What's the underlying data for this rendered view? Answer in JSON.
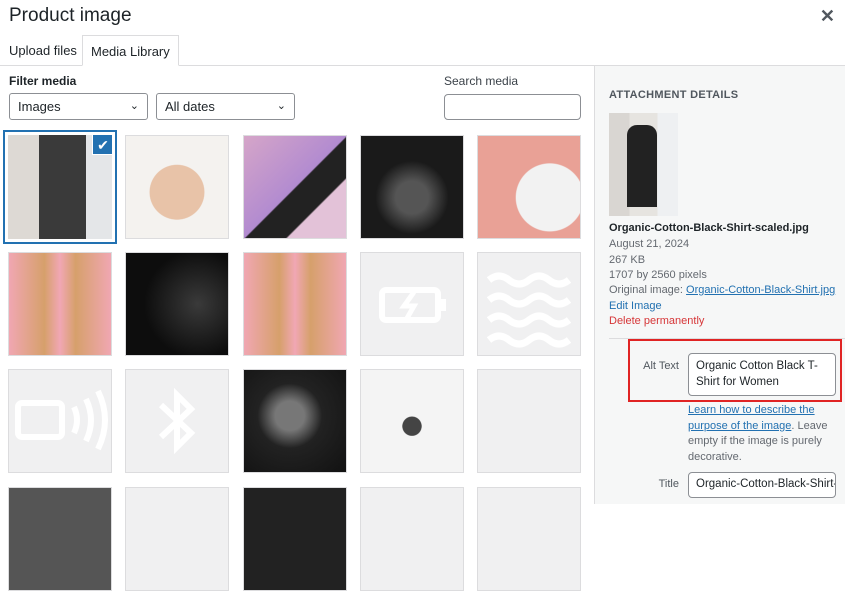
{
  "header": {
    "title": "Product image",
    "close_icon": "close-icon"
  },
  "tabs": [
    {
      "label": "Upload files"
    },
    {
      "label": "Media Library"
    }
  ],
  "filters": {
    "label": "Filter media",
    "type_value": "Images",
    "date_value": "All dates"
  },
  "search": {
    "label": "Search media",
    "value": ""
  },
  "tiles": [
    {
      "kind": "photo",
      "desc": "woman-black-shirt",
      "selected": true
    },
    {
      "kind": "photo",
      "desc": "pink-headphones"
    },
    {
      "kind": "photo",
      "desc": "headphones-on-laptop"
    },
    {
      "kind": "photo",
      "desc": "dark-headphones"
    },
    {
      "kind": "photo",
      "desc": "white-headphones-pink"
    },
    {
      "kind": "photo",
      "desc": "airpods-max-pink"
    },
    {
      "kind": "photo",
      "desc": "dark-closeup"
    },
    {
      "kind": "photo",
      "desc": "airpods-max-pink"
    },
    {
      "kind": "icon",
      "desc": "battery-charging-icon"
    },
    {
      "kind": "icon",
      "desc": "waves-icon"
    },
    {
      "kind": "icon",
      "desc": "speaker-waves-icon"
    },
    {
      "kind": "icon",
      "desc": "bluetooth-icon"
    },
    {
      "kind": "photo",
      "desc": "man-portrait-bw"
    },
    {
      "kind": "photo",
      "desc": "black-headphones-white"
    },
    {
      "kind": "blank",
      "desc": "blank"
    }
  ],
  "details": {
    "heading": "ATTACHMENT DETAILS",
    "filename": "Organic-Cotton-Black-Shirt-scaled.jpg",
    "date": "August 21, 2024",
    "size": "267 KB",
    "dimensions": "1707 by 2560 pixels",
    "original_label": "Original image:",
    "original_link": "Organic-Cotton-Black-Shirt.jpg",
    "edit": "Edit Image",
    "delete": "Delete permanently",
    "alt_label": "Alt Text",
    "alt_value": "Organic Cotton Black T-Shirt for Women",
    "help_link": "Learn how to describe the purpose of the image",
    "help_text": ". Leave empty if the image is purely decorative.",
    "title_label": "Title",
    "title_value": "Organic-Cotton-Black-Shirt-scaled"
  },
  "colors": {
    "accent": "#2271b1",
    "danger": "#d63638",
    "highlight": "#e02424"
  }
}
